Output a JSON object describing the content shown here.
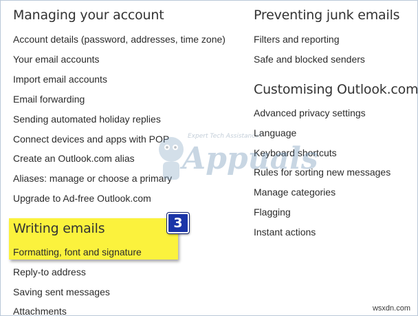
{
  "left_column": {
    "sections": [
      {
        "heading": "Managing your account",
        "links": [
          "Account details (password, addresses, time zone)",
          "Your email accounts",
          "Import email accounts",
          "Email forwarding",
          "Sending automated holiday replies",
          "Connect devices and apps with POP",
          "Create an Outlook.com alias",
          "Aliases: manage or choose a primary",
          "Upgrade to Ad-free Outlook.com"
        ]
      },
      {
        "heading": "Writing emails",
        "links": [
          "Formatting, font and signature",
          "Reply-to address",
          "Saving sent messages",
          "Attachments"
        ]
      }
    ]
  },
  "right_column": {
    "sections": [
      {
        "heading": "Preventing junk emails",
        "links": [
          "Filters and reporting",
          "Safe and blocked senders"
        ]
      },
      {
        "heading": "Customising Outlook.com",
        "links": [
          "Advanced privacy settings",
          "Language",
          "Keyboard shortcuts",
          "Rules for sorting new messages",
          "Manage categories",
          "Flagging",
          "Instant actions"
        ]
      }
    ]
  },
  "annotation": {
    "step_number": "3",
    "highlight_color": "#fbf23d",
    "badge_color": "#1b35a8"
  },
  "watermark": {
    "tagline": "Expert Tech Assistance!",
    "brand": "Appuals"
  },
  "site_mark": "wsxdn.com"
}
